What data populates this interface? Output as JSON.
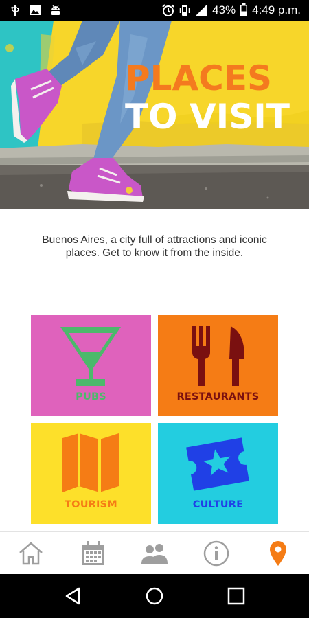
{
  "status_bar": {
    "battery_percent": "43%",
    "time": "4:49 p.m.",
    "icons": [
      "usb-icon",
      "image-icon",
      "android-icon",
      "alarm-icon",
      "vibrate-icon",
      "signal-icon",
      "battery-icon"
    ]
  },
  "hero": {
    "title_line1": "PLACES",
    "title_line2": "TO VISIT"
  },
  "description": "Buenos Aires, a city full of attractions and iconic places. Get to know it from the inside.",
  "tiles": [
    {
      "label": "PUBS",
      "color": "#df62bc",
      "label_color": "#4cb96b",
      "icon": "cocktail-glass-icon"
    },
    {
      "label": "RESTAURANTS",
      "color": "#f57c15",
      "label_color": "#7a1010",
      "icon": "fork-knife-icon"
    },
    {
      "label": "TOURISM",
      "color": "#fde02a",
      "label_color": "#f57c15",
      "icon": "folded-map-icon"
    },
    {
      "label": "CULTURE",
      "color": "#23cde0",
      "label_color": "#2040e6",
      "icon": "star-ticket-icon"
    }
  ],
  "bottom_nav": {
    "items": [
      "home-icon",
      "calendar-icon",
      "people-icon",
      "info-icon",
      "location-pin-icon"
    ],
    "active_index": 4,
    "active_color": "#f57c15",
    "inactive_color": "#9e9e9e"
  },
  "android_nav": [
    "back-icon",
    "home-circle-icon",
    "recents-icon"
  ]
}
